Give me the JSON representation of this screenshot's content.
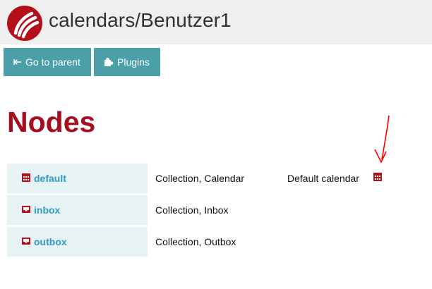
{
  "header": {
    "title": "calendars/Benutzer1",
    "logo_icon": "sabre-logo-icon"
  },
  "toolbar": {
    "parent_label": "Go to parent",
    "parent_icon": "arrow-to-left-icon",
    "plugins_label": "Plugins",
    "plugins_icon": "puzzle-piece-icon"
  },
  "main": {
    "heading": "Nodes",
    "nodes": [
      {
        "name": "default",
        "type": "Collection, Calendar",
        "description": "Default calendar",
        "icon": "calendar-icon"
      },
      {
        "name": "inbox",
        "type": "Collection, Inbox",
        "description": "",
        "icon": "inbox-icon"
      },
      {
        "name": "outbox",
        "type": "Collection, Outbox",
        "description": "",
        "icon": "outbox-icon"
      }
    ]
  },
  "colors": {
    "header_bg": "#efefef",
    "button_bg": "#4a9fa9",
    "heading": "#a50e1f",
    "link": "#2f9cc7",
    "name_cell_bg": "#e6f2f3",
    "icon": "#b3101c",
    "annotation_arrow": "#ff0000"
  }
}
